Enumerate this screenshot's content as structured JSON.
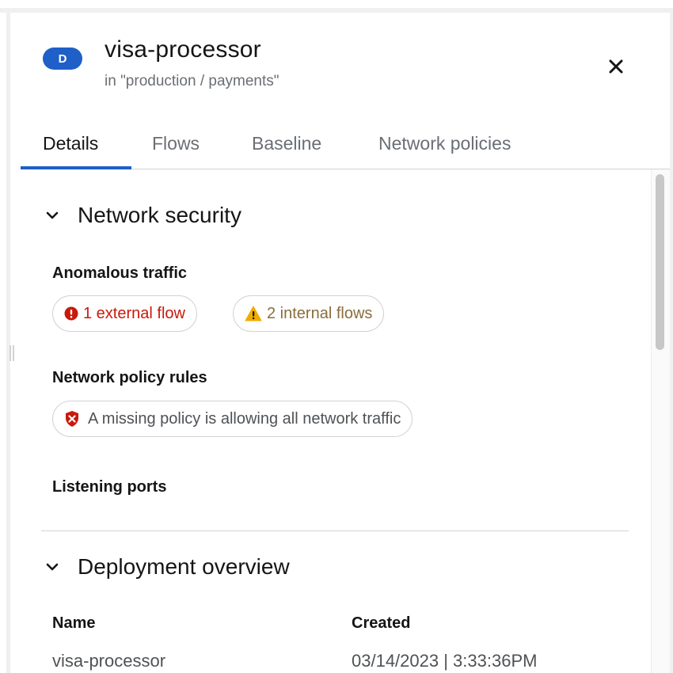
{
  "header": {
    "type_badge": "D",
    "title": "visa-processor",
    "subtitle": "in \"production / payments\"",
    "close_icon": "close-icon"
  },
  "tabs": [
    {
      "label": "Details",
      "active": true
    },
    {
      "label": "Flows",
      "active": false
    },
    {
      "label": "Baseline",
      "active": false
    },
    {
      "label": "Network policies",
      "active": false
    }
  ],
  "network_security": {
    "title": "Network security",
    "expanded": true,
    "anomalous_traffic": {
      "label": "Anomalous traffic",
      "external": {
        "text": "1 external flow",
        "icon": "exclamation-circle-icon",
        "color": "#c9190b"
      },
      "internal": {
        "text": "2 internal flows",
        "icon": "warning-triangle-icon",
        "color": "#f0ab00"
      }
    },
    "policy_rules": {
      "label": "Network policy rules",
      "status": {
        "text": "A missing policy is allowing all network traffic",
        "icon": "shield-x-icon",
        "color": "#c9190b"
      }
    },
    "listening_ports": {
      "label": "Listening ports"
    }
  },
  "deployment_overview": {
    "title": "Deployment overview",
    "expanded": true,
    "name_label": "Name",
    "name_value": "visa-processor",
    "created_label": "Created",
    "created_value": "03/14/2023 | 3:33:36PM"
  },
  "colors": {
    "accent": "#1f5fc8",
    "danger": "#c9190b",
    "warning": "#f0ab00"
  }
}
